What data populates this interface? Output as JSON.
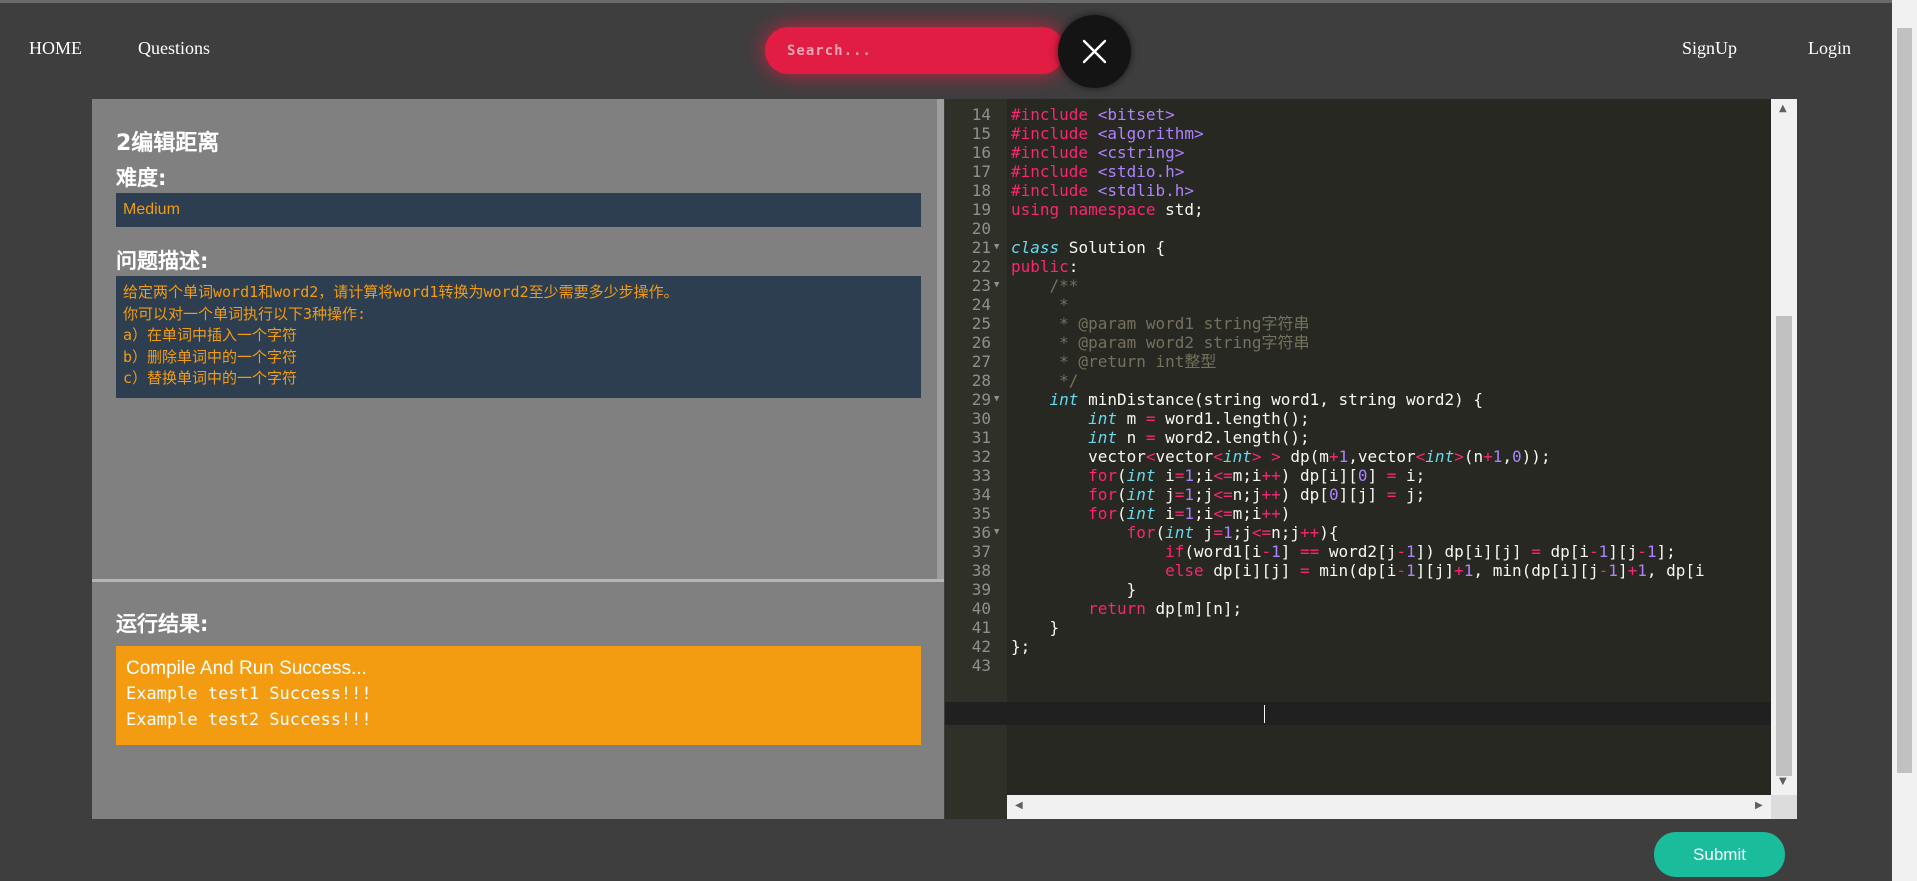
{
  "nav": {
    "home": "HOME",
    "questions": "Questions",
    "signup": "SignUp",
    "login": "Login"
  },
  "search": {
    "placeholder": "Search..."
  },
  "problem": {
    "title": "2编辑距离",
    "difficulty_label": "难度:",
    "difficulty": "Medium",
    "description_label": "问题描述:",
    "description": "给定两个单词word1和word2，请计算将word1转换为word2至少需要多少步操作。\n你可以对一个单词执行以下3种操作:\na）在单词中插入一个字符\nb）删除单词中的一个字符\nc）替换单词中的一个字符"
  },
  "result": {
    "label": "运行结果:",
    "lines": [
      "Compile And Run Success...",
      "Example test1 Success!!!",
      "Example test2 Success!!!"
    ]
  },
  "editor": {
    "first_line": 14,
    "active_line": 40,
    "foldable_lines": [
      21,
      23,
      29,
      36
    ],
    "lines": [
      "#include <bitset>",
      "#include <algorithm>",
      "#include <cstring>",
      "#include <stdio.h>",
      "#include <stdlib.h>",
      "using namespace std;",
      "",
      "class Solution {",
      "public:",
      "    /**",
      "     *",
      "     * @param word1 string字符串",
      "     * @param word2 string字符串",
      "     * @return int整型",
      "     */",
      "    int minDistance(string word1, string word2) {",
      "        int m = word1.length();",
      "        int n = word2.length();",
      "        vector<vector<int> > dp(m+1,vector<int>(n+1,0));",
      "        for(int i=1;i<=m;i++) dp[i][0] = i;",
      "        for(int j=1;j<=n;j++) dp[0][j] = j;",
      "        for(int i=1;i<=m;i++)",
      "            for(int j=1;j<=n;j++){",
      "                if(word1[i-1] == word2[j-1]) dp[i][j] = dp[i-1][j-1];",
      "                else dp[i][j] = min(dp[i-1][j]+1, min(dp[i][j-1]+1, dp[i",
      "            }",
      "        return dp[m][n];",
      "    }",
      "};",
      ""
    ]
  },
  "submit": {
    "label": "Submit"
  },
  "icons": {
    "close": "close-icon",
    "fold": "fold-arrow-icon"
  },
  "colors": {
    "search_bg": "#e11d43",
    "panel_bg": "#808080",
    "box_bg": "#2c3e50",
    "accent_text": "#f39c12",
    "result_bg": "#f39c12",
    "submit_bg": "#1abc9c",
    "editor_bg": "#272822"
  }
}
